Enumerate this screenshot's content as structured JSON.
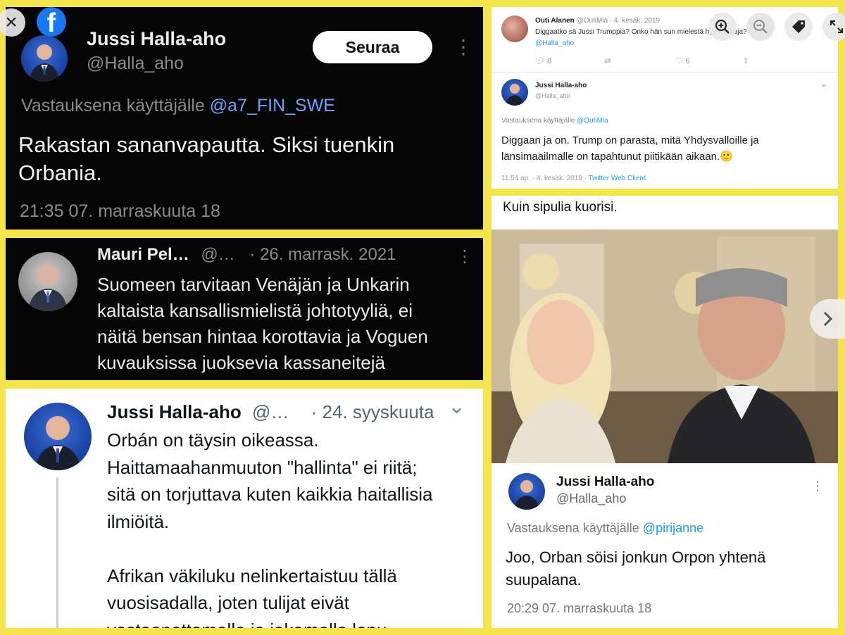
{
  "viewer": {
    "close_label": "×",
    "icons": [
      "close-icon",
      "facebook-icon",
      "zoom-in-icon",
      "zoom-out-icon",
      "tag-icon",
      "expand-icon",
      "chevron-right-icon"
    ]
  },
  "panel1": {
    "name": "Jussi Halla-aho",
    "handle": "@Halla_aho",
    "follow_label": "Seuraa",
    "more": "⋮",
    "reply_prefix": "Vastauksena käyttäjälle",
    "reply_handle": "@a7_FIN_SWE",
    "text": "Rakastan sananvapautta. Siksi tuenkin\nOrbania.",
    "time": "21:35 07. marraskuuta 18"
  },
  "panel2": {
    "name": "Mauri Pel…",
    "handle": "@…",
    "date": "· 26. marrask. 2021",
    "more": "⋮",
    "text": "Suomeen tarvitaan Venäjän ja Unkarin\nkaltaista kansallismielistä johtotyyliä, ei\nnäitä bensan hintaa korottavia ja Voguen\nkuvauksissa juoksevia kassaneitejä"
  },
  "panel3": {
    "name": "Jussi Halla-aho",
    "handle": "@…",
    "date": "· 24. syyskuuta",
    "chevron": "⌄",
    "text": "Orbán on täysin oikeassa.\nHaittamaahanmuuton \"hallinta\" ei riitä;\nsitä on torjuttava kuten kaikkia haitallisia\nilmiöitä.\n\nAfrikan väkiluku nelinkertaistuu tällä\nvuosisadalla, joten tulijat eivät\nvastaanottamalla ja jakamalla lopu."
  },
  "panel4": {
    "name1": "Outi Alanen",
    "handle1": "@OutiMia",
    "date1": "· 4. kesäk. 2019",
    "text1": "Diggaatko sä Jussi Trumppia? Onko hän sun mielestä hyvä johtaja?",
    "mention1": "@Halla_aho",
    "reply_count": "8",
    "like_count": "6",
    "name2": "Jussi Halla-aho",
    "handle2": "@Halla_aho",
    "reply_prefix": "Vastauksena käyttäjälle",
    "reply_handle": "@OutiMia",
    "text2": "Diggaan ja on. Trump on parasta, mitä Yhdysvalloille ja\nlänsimaailmalle on tapahtunut piitikään aikaan.🙂",
    "time": "11.54 ap. · 4. kesäk. 2019",
    "client": "Twitter Web Client"
  },
  "panel5": {
    "caption": "Kuin sipulia kuorisi.",
    "name": "Jussi Halla-aho",
    "handle": "@Halla_aho",
    "more": "⋮",
    "reply_prefix": "Vastauksena käyttäjälle",
    "reply_handle": "@pirijanne",
    "text": "Joo, Orban söisi jonkun Orpon yhtenä\nsuupalana.",
    "time": "20:29 07. marraskuuta 18"
  }
}
